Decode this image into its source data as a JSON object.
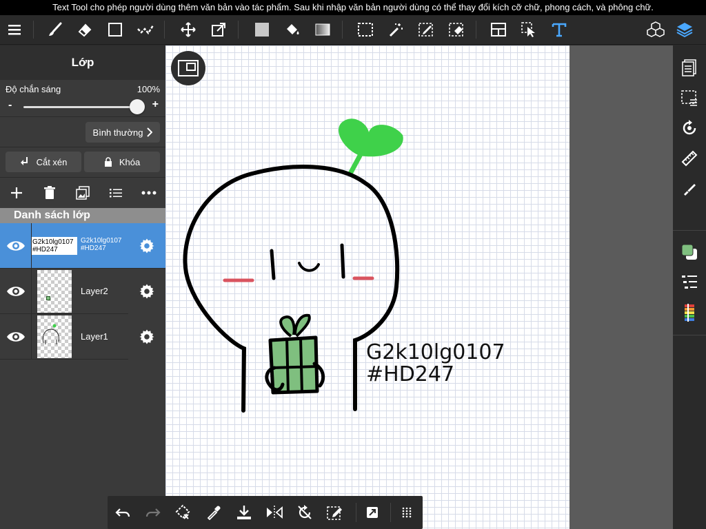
{
  "caption": "Text Tool cho phép người dùng thêm văn bản vào tác phẩm. Sau khi nhập văn bản người dùng có thể thay đổi kích cỡ chữ, phong cách, và phông chữ.",
  "colors": {
    "accent_blue": "#4a90d9",
    "panel_dark": "#2a2a2a",
    "panel_mid": "#3a3a3a",
    "sprout_green": "#3fd14a",
    "gift_green": "#7fbf7f",
    "blush_red": "#d9545f"
  },
  "top_toolbar": {
    "icons": [
      "menu-icon",
      "brush-icon",
      "eraser-icon",
      "square-icon",
      "selection-check-icon",
      "move-icon",
      "transform-icon",
      "fill-color-icon",
      "bucket-icon",
      "gradient-icon",
      "marquee-select-icon",
      "magic-wand-icon",
      "selection-pen-icon",
      "selection-eraser-icon",
      "frame-divider-icon",
      "operation-icon",
      "text-tool-icon",
      "materials-icon",
      "layers-icon"
    ]
  },
  "layer_panel": {
    "title": "Lớp",
    "opacity_label": "Độ chắn sáng",
    "opacity_value": "100%",
    "opacity": 1.0,
    "minus": "-",
    "plus": "+",
    "blend_mode": "Bình thường",
    "clip_label": "Cắt xén",
    "lock_label": "Khóa",
    "list_header": "Danh sách lớp",
    "layers": [
      {
        "name": "G2k10lg0107\n#HD247",
        "thumb_text": "G2k10lg0107\n#HD247",
        "selected": true
      },
      {
        "name": "Layer2",
        "selected": false
      },
      {
        "name": "Layer1",
        "selected": false
      }
    ]
  },
  "canvas": {
    "text": "G2k10lg0107\n#HD247"
  }
}
